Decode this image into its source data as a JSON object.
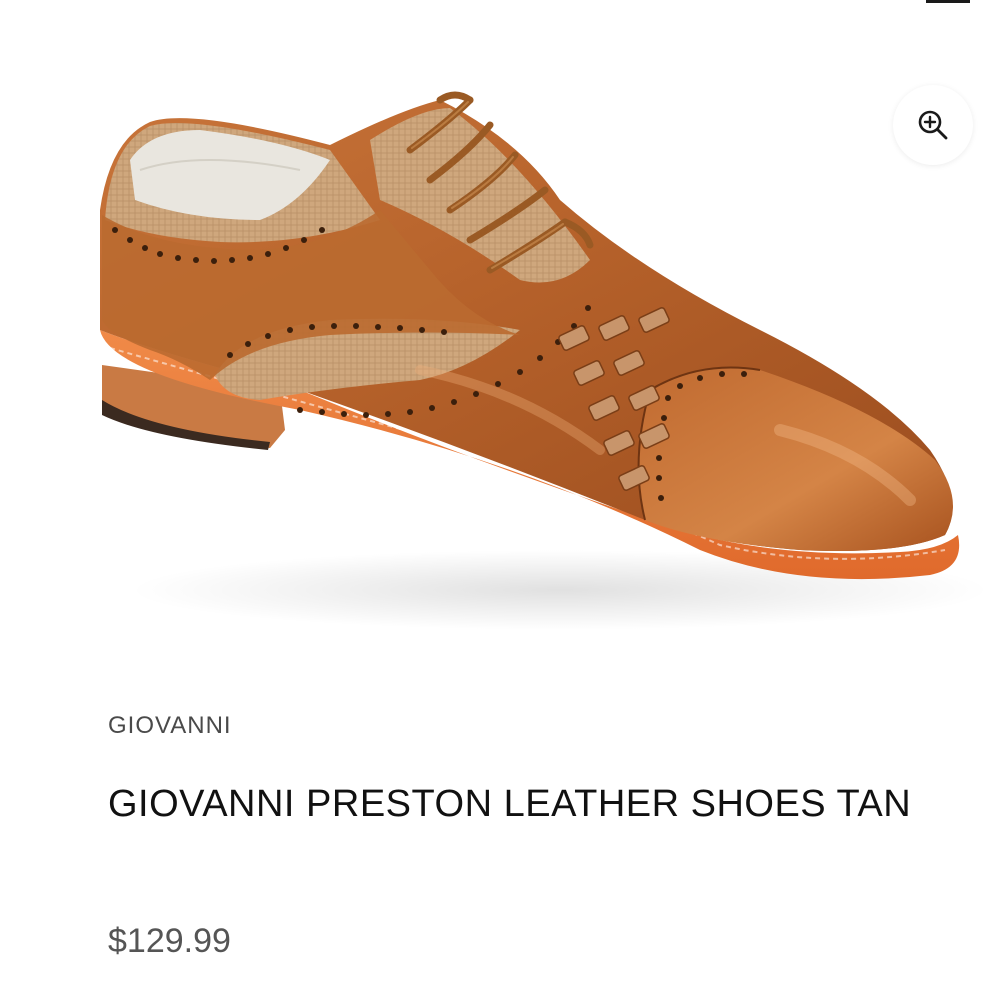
{
  "product": {
    "brand": "GIOVANNI",
    "title": "GIOVANNI PRESTON LEATHER SHOES TAN",
    "price": "$129.99"
  },
  "zoom": {
    "icon": "zoom-in-icon"
  },
  "colors": {
    "leather": "#b8652a",
    "leather_dark": "#8a4419",
    "linen": "#c9a27a",
    "sole": "#ef7f3f",
    "lace": "#a0622a",
    "text_dark": "#111111",
    "text_muted": "#4a4a4a",
    "price": "#555555"
  }
}
